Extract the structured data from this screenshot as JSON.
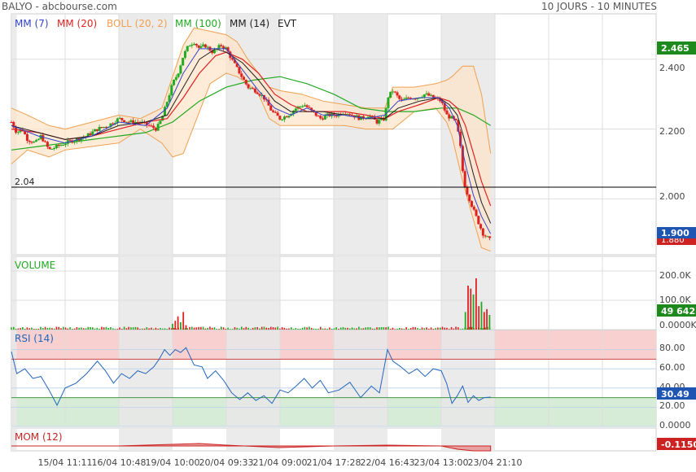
{
  "header": {
    "title": "BALYO - abcbourse.com",
    "period": "10 JOURS - 10 MINUTES"
  },
  "colors": {
    "mm7": "#3344cc",
    "mm20": "#dd2222",
    "boll": "#f0a050",
    "boll_fill": "#fde3c8",
    "mm100": "#22aa22",
    "mm14": "#222222",
    "price_label": "#2244bb",
    "up": "#22aa22",
    "down": "#dd2222",
    "rsi_line": "#2266bb",
    "rsi_over": "#f9d0d0",
    "rsi_under": "#d6ecd6",
    "shade": "#e8e8e8",
    "mom": "#cc2222",
    "volume_label": "#22aa22"
  },
  "chart_data": [
    {
      "type": "line",
      "name": "price",
      "legend": [
        "MM (7)",
        "MM (20)",
        "BOLL (20, 2)",
        "MM (100)",
        "MM (14)",
        "EVT"
      ],
      "ylim": [
        1.84,
        2.53
      ],
      "yticks": [
        2.4,
        2.2,
        2.0
      ],
      "ytick_labels": [
        "2.400",
        "2.200",
        "2.000"
      ],
      "reference_line": {
        "value": 2.04,
        "label": "2.04"
      },
      "last_value_labels": [
        {
          "text": "2.465"
        },
        {
          "text": "1.900"
        },
        {
          "text": "1.880"
        }
      ],
      "xlabels": [
        "15/04 11:11",
        "16/04 10:48",
        "19/04 10:00",
        "20/04 09:33",
        "21/04 09:00",
        "21/04 17:28",
        "22/04 16:43",
        "23/04 13:00",
        "23/04 21:10"
      ],
      "shaded_sessions": [
        [
          0,
          0.1
        ],
        [
          2,
          3
        ],
        [
          4,
          5
        ],
        [
          6,
          7
        ],
        [
          8,
          9
        ]
      ],
      "x_extent": 12,
      "close": [
        [
          0.0,
          2.22
        ],
        [
          0.1,
          2.19
        ],
        [
          0.2,
          2.2
        ],
        [
          0.3,
          2.17
        ],
        [
          0.45,
          2.16
        ],
        [
          0.55,
          2.18
        ],
        [
          0.7,
          2.14
        ],
        [
          0.85,
          2.15
        ],
        [
          1.0,
          2.16
        ],
        [
          1.2,
          2.17
        ],
        [
          1.4,
          2.18
        ],
        [
          1.6,
          2.2
        ],
        [
          1.8,
          2.21
        ],
        [
          2.0,
          2.23
        ],
        [
          2.2,
          2.22
        ],
        [
          2.4,
          2.22
        ],
        [
          2.55,
          2.21
        ],
        [
          2.7,
          2.2
        ],
        [
          2.8,
          2.23
        ],
        [
          2.9,
          2.28
        ],
        [
          3.0,
          2.33
        ],
        [
          3.1,
          2.36
        ],
        [
          3.2,
          2.41
        ],
        [
          3.3,
          2.44
        ],
        [
          3.4,
          2.45
        ],
        [
          3.5,
          2.43
        ],
        [
          3.6,
          2.44
        ],
        [
          3.75,
          2.42
        ],
        [
          3.9,
          2.44
        ],
        [
          4.0,
          2.43
        ],
        [
          4.1,
          2.4
        ],
        [
          4.25,
          2.36
        ],
        [
          4.4,
          2.32
        ],
        [
          4.55,
          2.31
        ],
        [
          4.7,
          2.29
        ],
        [
          4.85,
          2.25
        ],
        [
          5.0,
          2.23
        ],
        [
          5.15,
          2.24
        ],
        [
          5.3,
          2.26
        ],
        [
          5.45,
          2.27
        ],
        [
          5.6,
          2.25
        ],
        [
          5.75,
          2.23
        ],
        [
          5.9,
          2.24
        ],
        [
          6.05,
          2.24
        ],
        [
          6.2,
          2.25
        ],
        [
          6.35,
          2.24
        ],
        [
          6.5,
          2.23
        ],
        [
          6.65,
          2.24
        ],
        [
          6.8,
          2.22
        ],
        [
          6.95,
          2.23
        ],
        [
          7.0,
          2.29
        ],
        [
          7.1,
          2.31
        ],
        [
          7.25,
          2.28
        ],
        [
          7.4,
          2.29
        ],
        [
          7.55,
          2.29
        ],
        [
          7.7,
          2.3
        ],
        [
          7.85,
          2.29
        ],
        [
          8.0,
          2.28
        ],
        [
          8.1,
          2.24
        ],
        [
          8.2,
          2.23
        ],
        [
          8.28,
          2.22
        ],
        [
          8.35,
          2.16
        ],
        [
          8.4,
          2.08
        ],
        [
          8.45,
          2.03
        ],
        [
          8.5,
          2.01
        ],
        [
          8.55,
          1.99
        ],
        [
          8.62,
          1.96
        ],
        [
          8.7,
          1.93
        ],
        [
          8.78,
          1.9
        ],
        [
          8.85,
          1.89
        ],
        [
          8.92,
          1.88
        ]
      ],
      "ma7": [
        [
          0.0,
          2.21
        ],
        [
          0.5,
          2.18
        ],
        [
          1.0,
          2.16
        ],
        [
          1.5,
          2.18
        ],
        [
          2.0,
          2.22
        ],
        [
          2.5,
          2.21
        ],
        [
          2.9,
          2.26
        ],
        [
          3.2,
          2.36
        ],
        [
          3.5,
          2.43
        ],
        [
          3.8,
          2.43
        ],
        [
          4.0,
          2.43
        ],
        [
          4.3,
          2.37
        ],
        [
          4.6,
          2.31
        ],
        [
          4.9,
          2.26
        ],
        [
          5.2,
          2.24
        ],
        [
          5.5,
          2.26
        ],
        [
          5.8,
          2.24
        ],
        [
          6.2,
          2.24
        ],
        [
          6.6,
          2.23
        ],
        [
          6.95,
          2.24
        ],
        [
          7.2,
          2.28
        ],
        [
          7.6,
          2.29
        ],
        [
          7.95,
          2.29
        ],
        [
          8.15,
          2.26
        ],
        [
          8.3,
          2.21
        ],
        [
          8.45,
          2.1
        ],
        [
          8.6,
          2.01
        ],
        [
          8.75,
          1.95
        ],
        [
          8.92,
          1.9
        ]
      ],
      "ma14": [
        [
          0.0,
          2.21
        ],
        [
          0.5,
          2.19
        ],
        [
          1.0,
          2.17
        ],
        [
          1.5,
          2.18
        ],
        [
          2.0,
          2.21
        ],
        [
          2.5,
          2.22
        ],
        [
          2.9,
          2.24
        ],
        [
          3.2,
          2.32
        ],
        [
          3.5,
          2.4
        ],
        [
          3.8,
          2.43
        ],
        [
          4.0,
          2.42
        ],
        [
          4.3,
          2.39
        ],
        [
          4.6,
          2.34
        ],
        [
          4.9,
          2.28
        ],
        [
          5.2,
          2.25
        ],
        [
          5.5,
          2.25
        ],
        [
          5.8,
          2.25
        ],
        [
          6.2,
          2.24
        ],
        [
          6.6,
          2.23
        ],
        [
          6.95,
          2.23
        ],
        [
          7.2,
          2.26
        ],
        [
          7.6,
          2.28
        ],
        [
          7.95,
          2.29
        ],
        [
          8.15,
          2.27
        ],
        [
          8.3,
          2.24
        ],
        [
          8.45,
          2.16
        ],
        [
          8.6,
          2.07
        ],
        [
          8.75,
          1.99
        ],
        [
          8.92,
          1.93
        ]
      ],
      "ma20": [
        [
          0.0,
          2.2
        ],
        [
          0.5,
          2.19
        ],
        [
          1.0,
          2.17
        ],
        [
          1.5,
          2.18
        ],
        [
          2.0,
          2.2
        ],
        [
          2.5,
          2.22
        ],
        [
          2.9,
          2.23
        ],
        [
          3.2,
          2.29
        ],
        [
          3.5,
          2.36
        ],
        [
          3.8,
          2.41
        ],
        [
          4.0,
          2.42
        ],
        [
          4.3,
          2.4
        ],
        [
          4.6,
          2.36
        ],
        [
          4.9,
          2.3
        ],
        [
          5.2,
          2.27
        ],
        [
          5.5,
          2.25
        ],
        [
          5.8,
          2.25
        ],
        [
          6.2,
          2.25
        ],
        [
          6.6,
          2.24
        ],
        [
          6.95,
          2.23
        ],
        [
          7.2,
          2.25
        ],
        [
          7.6,
          2.27
        ],
        [
          7.95,
          2.29
        ],
        [
          8.15,
          2.28
        ],
        [
          8.3,
          2.26
        ],
        [
          8.45,
          2.21
        ],
        [
          8.6,
          2.13
        ],
        [
          8.75,
          2.05
        ],
        [
          8.92,
          1.98
        ]
      ],
      "ma100": [
        [
          0.0,
          2.14
        ],
        [
          0.5,
          2.15
        ],
        [
          1.0,
          2.16
        ],
        [
          1.5,
          2.17
        ],
        [
          2.0,
          2.18
        ],
        [
          2.5,
          2.19
        ],
        [
          3.0,
          2.22
        ],
        [
          3.5,
          2.28
        ],
        [
          4.0,
          2.32
        ],
        [
          4.5,
          2.34
        ],
        [
          5.0,
          2.35
        ],
        [
          5.5,
          2.33
        ],
        [
          6.0,
          2.3
        ],
        [
          6.5,
          2.26
        ],
        [
          7.0,
          2.25
        ],
        [
          7.5,
          2.25
        ],
        [
          8.0,
          2.26
        ],
        [
          8.3,
          2.26
        ],
        [
          8.6,
          2.24
        ],
        [
          8.92,
          2.21
        ]
      ],
      "boll_upper": [
        [
          0.0,
          2.26
        ],
        [
          0.3,
          2.24
        ],
        [
          0.7,
          2.21
        ],
        [
          1.0,
          2.2
        ],
        [
          1.5,
          2.22
        ],
        [
          2.0,
          2.24
        ],
        [
          2.4,
          2.23
        ],
        [
          2.8,
          2.26
        ],
        [
          3.0,
          2.35
        ],
        [
          3.2,
          2.44
        ],
        [
          3.4,
          2.49
        ],
        [
          3.7,
          2.48
        ],
        [
          4.0,
          2.47
        ],
        [
          4.2,
          2.45
        ],
        [
          4.4,
          2.4
        ],
        [
          4.6,
          2.36
        ],
        [
          4.8,
          2.32
        ],
        [
          5.0,
          2.31
        ],
        [
          5.4,
          2.3
        ],
        [
          5.8,
          2.28
        ],
        [
          6.2,
          2.27
        ],
        [
          6.6,
          2.26
        ],
        [
          6.95,
          2.26
        ],
        [
          7.1,
          2.32
        ],
        [
          7.5,
          2.32
        ],
        [
          7.9,
          2.33
        ],
        [
          8.1,
          2.34
        ],
        [
          8.2,
          2.35
        ],
        [
          8.4,
          2.38
        ],
        [
          8.6,
          2.38
        ],
        [
          8.75,
          2.3
        ],
        [
          8.92,
          2.13
        ]
      ],
      "boll_lower": [
        [
          0.0,
          2.1
        ],
        [
          0.3,
          2.14
        ],
        [
          0.7,
          2.12
        ],
        [
          1.0,
          2.14
        ],
        [
          1.5,
          2.15
        ],
        [
          2.0,
          2.16
        ],
        [
          2.4,
          2.2
        ],
        [
          2.8,
          2.16
        ],
        [
          3.0,
          2.12
        ],
        [
          3.2,
          2.13
        ],
        [
          3.4,
          2.21
        ],
        [
          3.7,
          2.33
        ],
        [
          4.0,
          2.36
        ],
        [
          4.2,
          2.35
        ],
        [
          4.4,
          2.33
        ],
        [
          4.6,
          2.3
        ],
        [
          4.8,
          2.23
        ],
        [
          5.0,
          2.21
        ],
        [
          5.4,
          2.21
        ],
        [
          5.8,
          2.21
        ],
        [
          6.2,
          2.21
        ],
        [
          6.6,
          2.2
        ],
        [
          6.95,
          2.2
        ],
        [
          7.1,
          2.2
        ],
        [
          7.5,
          2.25
        ],
        [
          7.9,
          2.26
        ],
        [
          8.1,
          2.22
        ],
        [
          8.2,
          2.18
        ],
        [
          8.4,
          2.05
        ],
        [
          8.6,
          1.94
        ],
        [
          8.75,
          1.86
        ],
        [
          8.92,
          1.85
        ]
      ]
    },
    {
      "type": "bar",
      "name": "volume",
      "title": "VOLUME",
      "ylim": [
        0,
        250000
      ],
      "yticks": [
        200000,
        100000,
        0
      ],
      "ytick_labels": [
        "200.0K",
        "100.0K",
        "0.0000K"
      ],
      "last_value_label": "49 642",
      "bars": [
        [
          3.0,
          20000
        ],
        [
          3.05,
          30000
        ],
        [
          3.1,
          45000
        ],
        [
          3.15,
          25000
        ],
        [
          3.2,
          60000
        ],
        [
          3.25,
          15000
        ],
        [
          8.45,
          60000
        ],
        [
          8.5,
          150000
        ],
        [
          8.55,
          140000
        ],
        [
          8.6,
          120000
        ],
        [
          8.65,
          175000
        ],
        [
          8.7,
          80000
        ],
        [
          8.75,
          95000
        ],
        [
          8.8,
          60000
        ],
        [
          8.85,
          70000
        ],
        [
          8.9,
          50000
        ]
      ]
    },
    {
      "type": "line",
      "name": "rsi",
      "title": "RSI (14)",
      "ylim": [
        0,
        100
      ],
      "yticks": [
        80,
        60,
        40,
        20,
        0
      ],
      "ytick_labels": [
        "80.00",
        "60.00",
        "40.00",
        "20.00",
        "0.0000"
      ],
      "overbought": 70,
      "oversold": 30,
      "last_value_label": "30.49",
      "values": [
        [
          0.0,
          78
        ],
        [
          0.1,
          55
        ],
        [
          0.25,
          60
        ],
        [
          0.4,
          50
        ],
        [
          0.55,
          52
        ],
        [
          0.7,
          38
        ],
        [
          0.85,
          22
        ],
        [
          1.0,
          40
        ],
        [
          1.2,
          45
        ],
        [
          1.4,
          55
        ],
        [
          1.6,
          68
        ],
        [
          1.75,
          58
        ],
        [
          1.9,
          45
        ],
        [
          2.05,
          55
        ],
        [
          2.2,
          50
        ],
        [
          2.35,
          58
        ],
        [
          2.5,
          55
        ],
        [
          2.65,
          62
        ],
        [
          2.75,
          70
        ],
        [
          2.85,
          80
        ],
        [
          2.95,
          74
        ],
        [
          3.05,
          80
        ],
        [
          3.15,
          77
        ],
        [
          3.25,
          82
        ],
        [
          3.4,
          64
        ],
        [
          3.55,
          62
        ],
        [
          3.65,
          50
        ],
        [
          3.8,
          58
        ],
        [
          3.95,
          48
        ],
        [
          4.1,
          35
        ],
        [
          4.25,
          28
        ],
        [
          4.4,
          35
        ],
        [
          4.55,
          27
        ],
        [
          4.7,
          32
        ],
        [
          4.85,
          24
        ],
        [
          5.0,
          38
        ],
        [
          5.15,
          35
        ],
        [
          5.3,
          42
        ],
        [
          5.45,
          50
        ],
        [
          5.6,
          40
        ],
        [
          5.75,
          48
        ],
        [
          5.9,
          35
        ],
        [
          6.1,
          38
        ],
        [
          6.3,
          46
        ],
        [
          6.5,
          30
        ],
        [
          6.7,
          42
        ],
        [
          6.85,
          35
        ],
        [
          7.0,
          80
        ],
        [
          7.1,
          68
        ],
        [
          7.25,
          62
        ],
        [
          7.4,
          55
        ],
        [
          7.55,
          60
        ],
        [
          7.7,
          52
        ],
        [
          7.85,
          60
        ],
        [
          8.0,
          58
        ],
        [
          8.1,
          45
        ],
        [
          8.2,
          24
        ],
        [
          8.3,
          32
        ],
        [
          8.4,
          42
        ],
        [
          8.5,
          25
        ],
        [
          8.6,
          32
        ],
        [
          8.7,
          27
        ],
        [
          8.8,
          30
        ],
        [
          8.92,
          30.49
        ]
      ]
    },
    {
      "type": "area",
      "name": "momentum",
      "title": "MOM (12)",
      "last_value_label": "-0.1150",
      "values": [
        [
          0.0,
          0.0
        ],
        [
          1.0,
          0.0
        ],
        [
          2.0,
          0.0
        ],
        [
          3.0,
          0.02
        ],
        [
          3.5,
          0.03
        ],
        [
          4.0,
          0.01
        ],
        [
          5.0,
          -0.02
        ],
        [
          6.0,
          0.0
        ],
        [
          7.0,
          0.01
        ],
        [
          8.0,
          0.0
        ],
        [
          8.3,
          -0.04
        ],
        [
          8.6,
          -0.1
        ],
        [
          8.92,
          -0.115
        ]
      ]
    }
  ]
}
